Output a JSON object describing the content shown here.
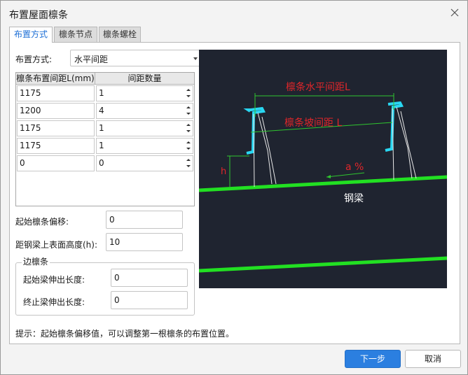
{
  "window": {
    "title": "布置屋面檩条"
  },
  "tabs": [
    {
      "label": "布置方式",
      "active": true
    },
    {
      "label": "檩条节点",
      "active": false
    },
    {
      "label": "檩条螺栓",
      "active": false
    }
  ],
  "layout_mode": {
    "label": "布置方式:",
    "value": "水平间距"
  },
  "spacing_table": {
    "headers": [
      "檩条布置间距L(mm)",
      "间距数量"
    ],
    "rows": [
      [
        "1175",
        "1"
      ],
      [
        "1200",
        "4"
      ],
      [
        "1175",
        "1"
      ],
      [
        "1175",
        "1"
      ],
      [
        "0",
        "0"
      ]
    ]
  },
  "start_offset": {
    "label": "起始檩条偏移:",
    "value": "0"
  },
  "beam_top_height": {
    "label": "距钢梁上表面高度(h):",
    "value": "10"
  },
  "edge_purlin": {
    "title": "边檩条",
    "start_extend": {
      "label": "起始梁伸出长度:",
      "value": "0"
    },
    "end_extend": {
      "label": "终止梁伸出长度:",
      "value": "0"
    }
  },
  "preview": {
    "horizontal_spacing_label": "檩条水平间距L",
    "slope_spacing_label": "檩条坡间距 L",
    "slope_label": "a %",
    "height_label": "h",
    "beam_label": "钢梁",
    "colors": {
      "background": "#1f2430",
      "beam": "#22e022",
      "purlin": "#29d7f2",
      "dimension": "#2fc62f",
      "text_red": "#e0262a"
    }
  },
  "hint": "提示：起始檩条偏移值，可以调整第一根檩条的布置位置。",
  "buttons": {
    "next": "下一步",
    "cancel": "取消"
  },
  "colors": {
    "accent": "#2b7fe0",
    "tab_active_text": "#1d6fd6"
  }
}
